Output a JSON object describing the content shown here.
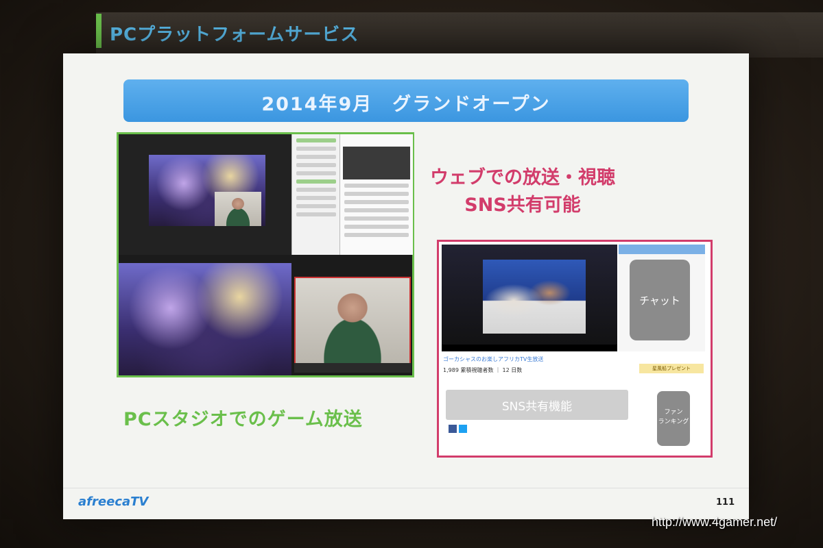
{
  "slide": {
    "section_title": "PCプラットフォームサービス",
    "banner": "2014年9月　グランドオープン",
    "left_caption": "PCスタジオでのゲーム放送",
    "right_heading_line1": "ウェブでの放送・視聴",
    "right_heading_line2": "SNS共有可能",
    "chat_label": "チャット",
    "sns_label": "SNS共有機能",
    "ranking_label_line1": "ファン",
    "ranking_label_line2": "ランキング",
    "stream_title": "ゴーカシャスのお楽しアフリカTV生放送",
    "stats_text": "1,989 累積視聴者数 ｜ 12 日数",
    "present_label": "星風船プレゼント",
    "logo": "afreecaTV",
    "page_number": "111"
  },
  "watermark": "http://www.4gamer.net/"
}
